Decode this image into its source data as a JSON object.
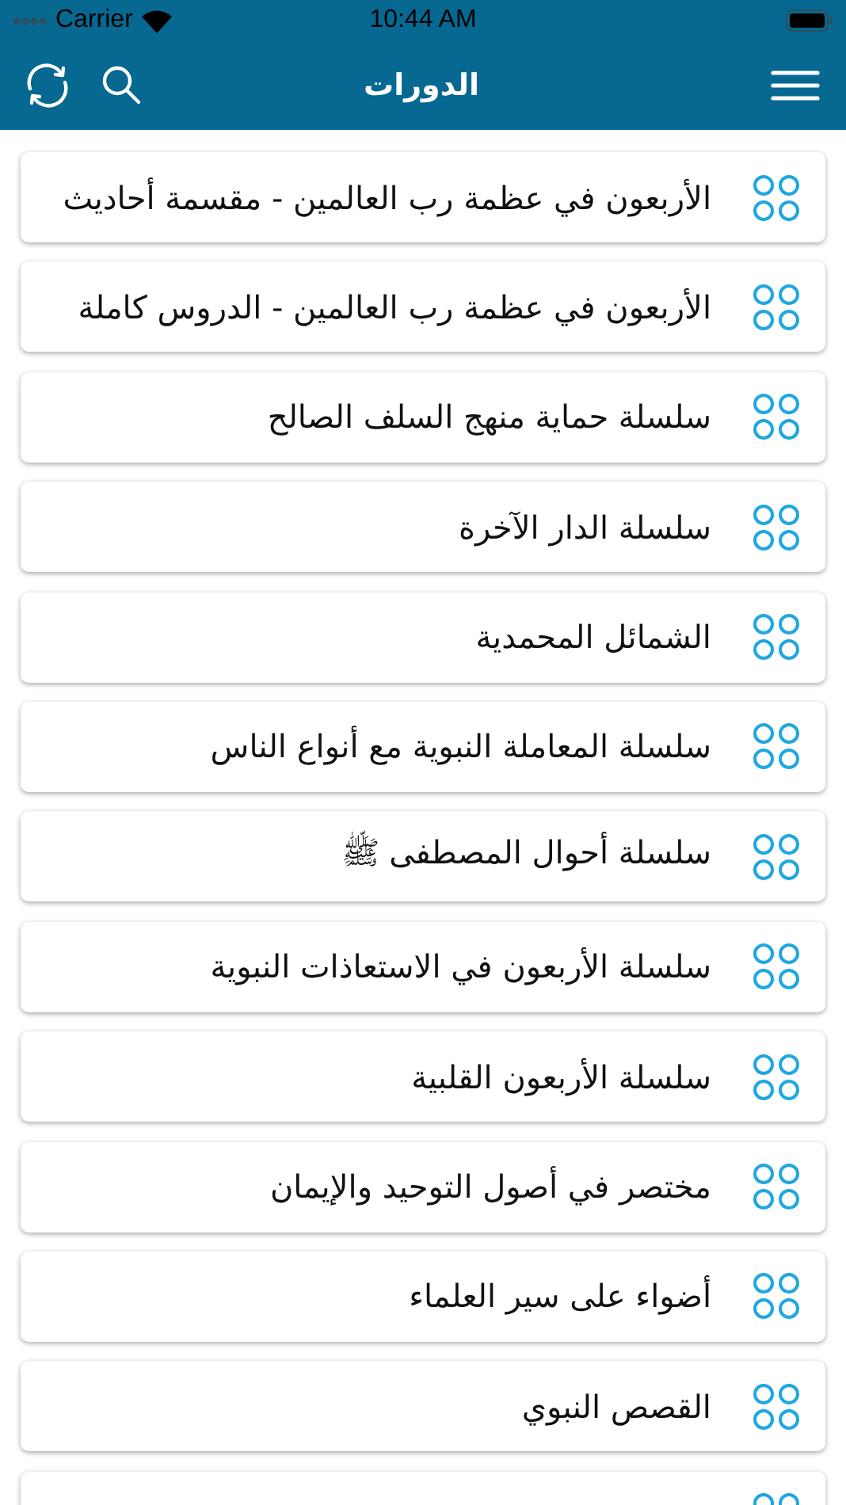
{
  "status_bar": {
    "carrier": "Carrier",
    "time": "10:44 AM"
  },
  "nav_bar": {
    "title": "الدورات"
  },
  "courses": [
    {
      "kind": "full",
      "title": "الأربعون في عظمة رب العالمين - مقسمة أحاديث"
    },
    {
      "kind": "full",
      "title": "الأربعون في عظمة رب العالمين - الدروس كاملة"
    },
    {
      "kind": "full",
      "title": "سلسلة حماية منهج السلف الصالح"
    },
    {
      "kind": "full",
      "title": "سلسلة الدار الآخرة"
    },
    {
      "kind": "full",
      "title": "الشمائل المحمدية"
    },
    {
      "kind": "full",
      "title": "سلسلة المعاملة النبوية مع أنواع الناس"
    },
    {
      "kind": "full",
      "title": "سلسلة أحوال المصطفى ﷺ"
    },
    {
      "kind": "full",
      "title": "سلسلة الأربعون في الاستعاذات النبوية"
    },
    {
      "kind": "full",
      "title": "سلسلة الأربعون القلبية"
    },
    {
      "kind": "full",
      "title": "مختصر في أصول التوحيد والإيمان"
    },
    {
      "kind": "full",
      "title": "أضواء على سير العلماء"
    },
    {
      "kind": "full",
      "title": "القصص النبوي"
    },
    {
      "kind": "cut"
    }
  ]
}
